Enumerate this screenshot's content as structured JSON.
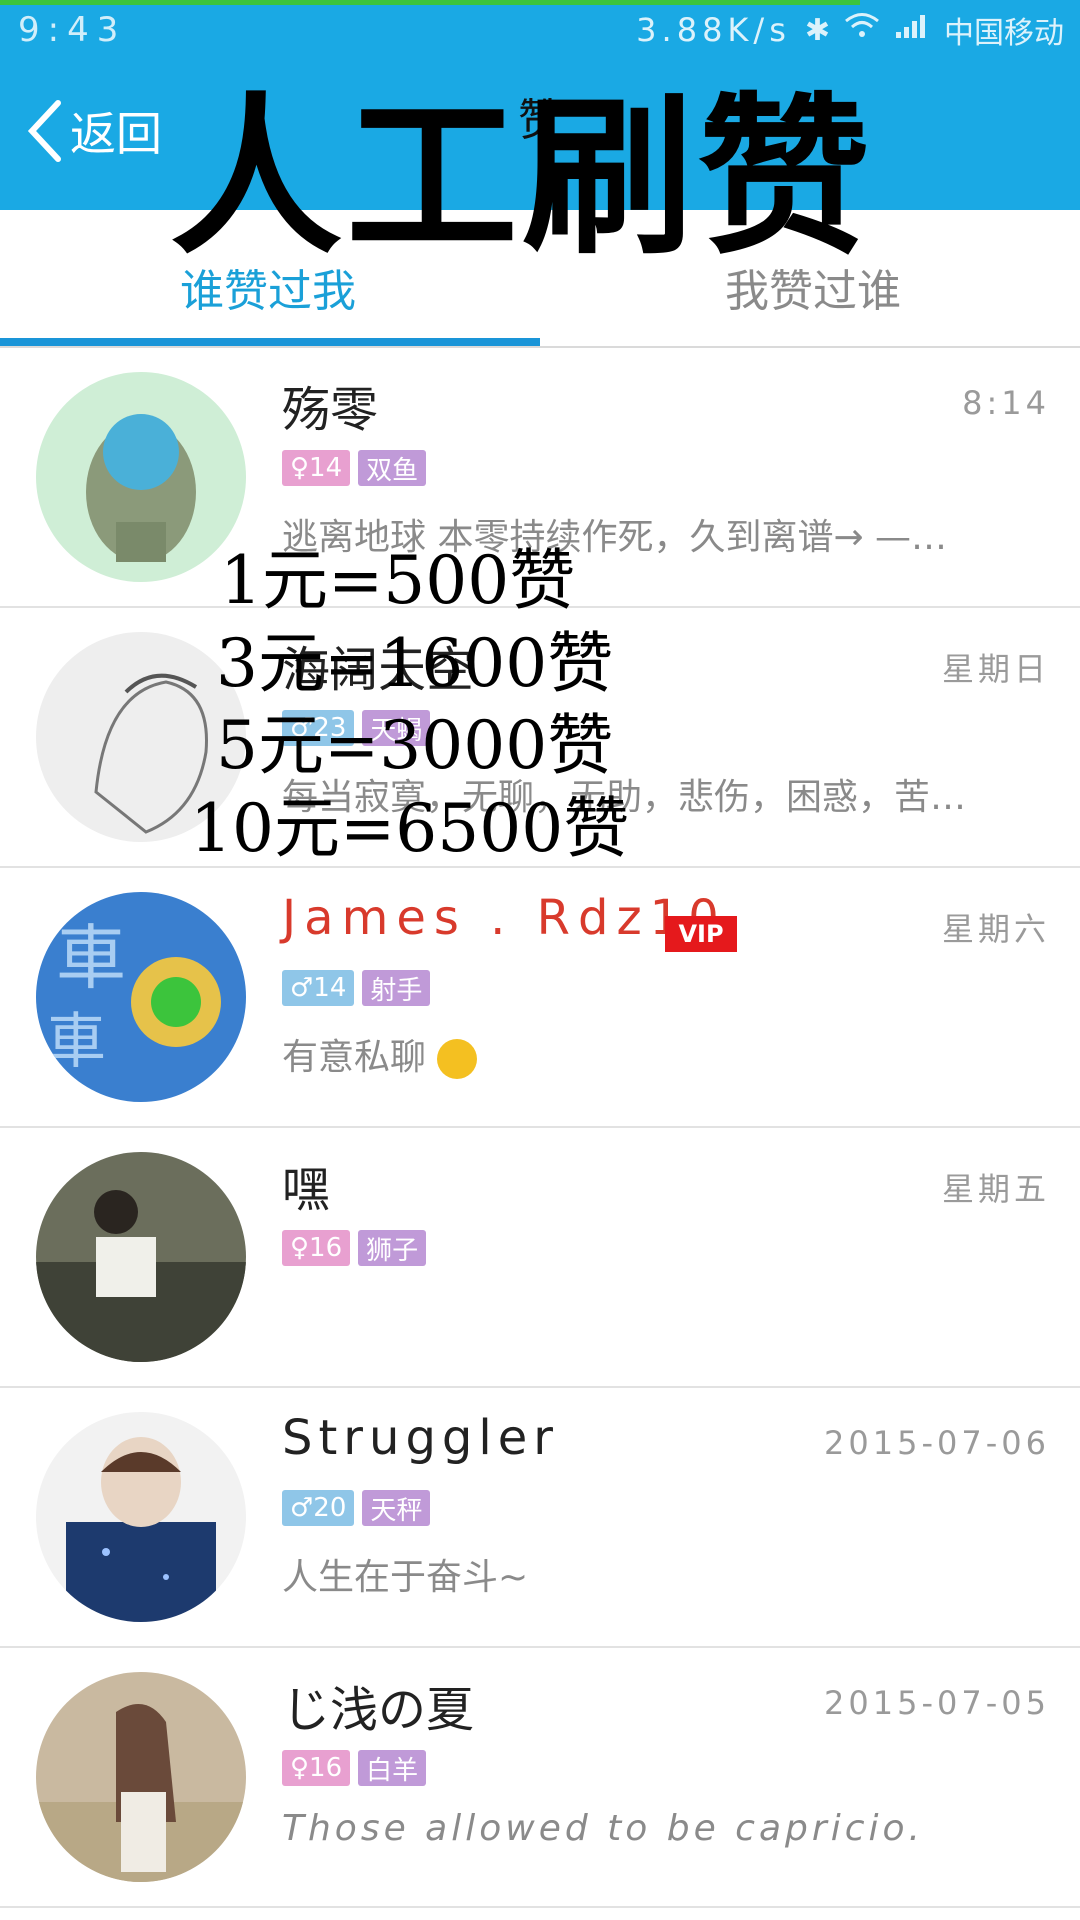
{
  "status_bar": {
    "time": "9:43",
    "speed": "3.88K/s",
    "carrier": "中国移动"
  },
  "header": {
    "back_label": "返回",
    "title": "赞"
  },
  "tabs": {
    "left": "谁赞过我",
    "right": "我赞过谁"
  },
  "overlay": {
    "title": "人工刷赞",
    "prices": [
      "1元=500赞",
      "3元=1600赞",
      "5元=3000赞",
      "10元=6500赞"
    ]
  },
  "list": [
    {
      "name": "殇零",
      "time": "8:14",
      "gender": "♀14",
      "zodiac": "双鱼",
      "signature": "逃离地球 本零持续作死，久到离谱→ —…",
      "gender_color": "#e8a0d0",
      "avatar_color": "#cfeed6"
    },
    {
      "name": "海阔天空",
      "time": "星期日",
      "gender": "♂23",
      "zodiac": "天蝎",
      "signature": "每当寂寞，无聊，无助，悲伤，困惑，苦…",
      "gender_color": "#8fc6e8",
      "avatar_color": "#e8e8e8"
    },
    {
      "name": "James . Rdz10",
      "vip": "VIP",
      "time": "星期六",
      "gender": "♂14",
      "zodiac": "射手",
      "signature": "有意私聊",
      "gender_color": "#8fc6e8",
      "avatar_color": "#3a7fcf"
    },
    {
      "name": "嘿",
      "time": "星期五",
      "gender": "♀16",
      "zodiac": "狮子",
      "signature": "",
      "gender_color": "#e8a0d0",
      "avatar_color": "#6b6e5c"
    },
    {
      "name": "Struggler",
      "time": "2015-07-06",
      "gender": "♂20",
      "zodiac": "天秤",
      "signature": "人生在于奋斗~",
      "gender_color": "#8fc6e8",
      "avatar_color": "#1d3a6e"
    },
    {
      "name": "じ浅の夏",
      "time": "2015-07-05",
      "gender": "♀16",
      "zodiac": "白羊",
      "signature": "Those allowed to be capricio.",
      "gender_color": "#e8a0d0",
      "avatar_color": "#c9b9a0"
    }
  ]
}
